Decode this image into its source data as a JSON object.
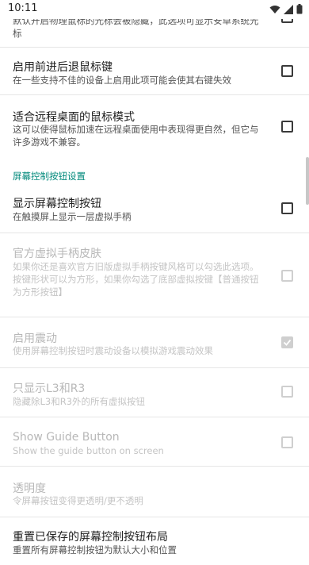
{
  "status_bar": {
    "time": "10:11"
  },
  "prefs": [
    {
      "id": "top_partial",
      "summary": "默认开启物理鼠标的光标会被隐藏，此选项可显示安卓系统光标"
    },
    {
      "id": "forward_back",
      "title": "启用前进后退鼠标键",
      "summary": "在一些支持不佳的设备上启用此项可能会使其右键失效",
      "checked": false,
      "enabled": true
    },
    {
      "id": "remote_desktop",
      "title": "适合远程桌面的鼠标模式",
      "summary": "这可以使得鼠标加速在远程桌面使用中表现得更自然，但它与许多游戏不兼容。",
      "checked": false,
      "enabled": true
    },
    {
      "id": "show_osc",
      "title": "显示屏幕控制按钮",
      "summary": "在触摸屏上显示一层虚拟手柄",
      "checked": false,
      "enabled": true
    },
    {
      "id": "skin",
      "title": "官方虚拟手柄皮肤",
      "summary": "如果你还是喜欢官方旧版虚拟手柄按键风格可以勾选此选项。\n按键形状可以为方形，如果你勾选了底部虚拟按键【普通按钮为方形按钮】",
      "checked": false,
      "enabled": false
    },
    {
      "id": "vibrate",
      "title": "启用震动",
      "summary": "使用屏幕控制按钮时震动设备以模拟游戏震动效果",
      "checked": true,
      "enabled": false
    },
    {
      "id": "l3r3",
      "title": "只显示L3和R3",
      "summary": "隐藏除L3和R3外的所有虚拟按钮",
      "checked": false,
      "enabled": false
    },
    {
      "id": "guide",
      "title": "Show Guide Button",
      "summary": "Show the guide button on screen",
      "checked": false,
      "enabled": false
    },
    {
      "id": "opacity",
      "title": "透明度",
      "summary": "令屏幕按钮变得更透明/更不透明",
      "enabled": false
    },
    {
      "id": "reset",
      "title": "重置已保存的屏幕控制按钮布局",
      "summary": "重置所有屏幕控制按钮为默认大小和位置",
      "enabled": true
    }
  ],
  "category": {
    "label": "屏幕控制按钮设置",
    "color": "#00897b"
  }
}
